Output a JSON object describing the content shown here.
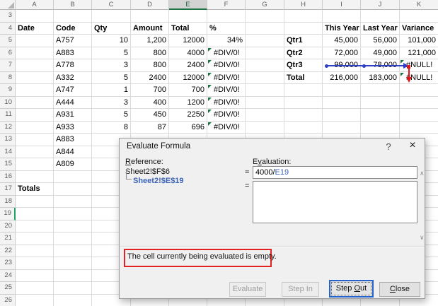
{
  "colors": {
    "excel_green": "#217346",
    "active_row_marker": "#21A366",
    "error_indicator": "#1E7145",
    "trace_blue": "#2F3FC6",
    "trace_red": "#DD1A1A",
    "reference_blue": "#3B63B8",
    "message_border_red": "#E32121",
    "focused_button_border": "#2663CC"
  },
  "icons": {
    "help": "?",
    "close": "×",
    "scroll_up": "∧",
    "scroll_down": "∨"
  },
  "sheet": {
    "columns": [
      "A",
      "B",
      "C",
      "D",
      "E",
      "F",
      "G",
      "H",
      "I",
      "J",
      "K"
    ],
    "selected_column": "E",
    "row_numbers": [
      3,
      4,
      5,
      6,
      7,
      8,
      9,
      10,
      11,
      12,
      13,
      14,
      15,
      16,
      17,
      18,
      19,
      20,
      21,
      22,
      23,
      24,
      25,
      26
    ],
    "active_row": 19,
    "cells": [
      {
        "ref": "A4",
        "text": "Date",
        "bold": true
      },
      {
        "ref": "B4",
        "text": "Code",
        "bold": true
      },
      {
        "ref": "C4",
        "text": "Qty",
        "bold": true
      },
      {
        "ref": "D4",
        "text": "Amount",
        "bold": true
      },
      {
        "ref": "E4",
        "text": "Total",
        "bold": true
      },
      {
        "ref": "F4",
        "text": "%",
        "bold": true
      },
      {
        "ref": "I4",
        "text": "This Year",
        "bold": true
      },
      {
        "ref": "J4",
        "text": "Last Year",
        "bold": true
      },
      {
        "ref": "K4",
        "text": "Variance",
        "bold": true
      },
      {
        "ref": "B5",
        "text": "A757"
      },
      {
        "ref": "C5",
        "text": "10",
        "align": "right"
      },
      {
        "ref": "D5",
        "text": "1,200",
        "align": "right"
      },
      {
        "ref": "E5",
        "text": "12000",
        "align": "right"
      },
      {
        "ref": "F5",
        "text": "34%",
        "align": "right"
      },
      {
        "ref": "H5",
        "text": "Qtr1",
        "bold": true
      },
      {
        "ref": "I5",
        "text": "45,000",
        "align": "right"
      },
      {
        "ref": "J5",
        "text": "56,000",
        "align": "right"
      },
      {
        "ref": "K5",
        "text": "101,000",
        "align": "right"
      },
      {
        "ref": "B6",
        "text": "A883"
      },
      {
        "ref": "C6",
        "text": "5",
        "align": "right"
      },
      {
        "ref": "D6",
        "text": "800",
        "align": "right"
      },
      {
        "ref": "E6",
        "text": "4000",
        "align": "right"
      },
      {
        "ref": "F6",
        "text": "#DIV/0!",
        "err": true
      },
      {
        "ref": "H6",
        "text": "Qtr2",
        "bold": true
      },
      {
        "ref": "I6",
        "text": "72,000",
        "align": "right"
      },
      {
        "ref": "J6",
        "text": "49,000",
        "align": "right"
      },
      {
        "ref": "K6",
        "text": "121,000",
        "align": "right"
      },
      {
        "ref": "B7",
        "text": "A778"
      },
      {
        "ref": "C7",
        "text": "3",
        "align": "right"
      },
      {
        "ref": "D7",
        "text": "800",
        "align": "right"
      },
      {
        "ref": "E7",
        "text": "2400",
        "align": "right"
      },
      {
        "ref": "F7",
        "text": "#DIV/0!",
        "err": true
      },
      {
        "ref": "H7",
        "text": "Qtr3",
        "bold": true
      },
      {
        "ref": "I7",
        "text": "99,000",
        "align": "right"
      },
      {
        "ref": "J7",
        "text": "78,000",
        "align": "right"
      },
      {
        "ref": "K7",
        "text": "#NULL!",
        "err": true
      },
      {
        "ref": "B8",
        "text": "A332"
      },
      {
        "ref": "C8",
        "text": "5",
        "align": "right"
      },
      {
        "ref": "D8",
        "text": "2400",
        "align": "right"
      },
      {
        "ref": "E8",
        "text": "12000",
        "align": "right"
      },
      {
        "ref": "F8",
        "text": "#DIV/0!",
        "err": true
      },
      {
        "ref": "H8",
        "text": "Total",
        "bold": true
      },
      {
        "ref": "I8",
        "text": "216,000",
        "align": "right"
      },
      {
        "ref": "J8",
        "text": "183,000",
        "align": "right"
      },
      {
        "ref": "K8",
        "text": "#NULL!",
        "err": true
      },
      {
        "ref": "B9",
        "text": "A747"
      },
      {
        "ref": "C9",
        "text": "1",
        "align": "right"
      },
      {
        "ref": "D9",
        "text": "700",
        "align": "right"
      },
      {
        "ref": "E9",
        "text": "700",
        "align": "right"
      },
      {
        "ref": "F9",
        "text": "#DIV/0!",
        "err": true
      },
      {
        "ref": "B10",
        "text": "A444"
      },
      {
        "ref": "C10",
        "text": "3",
        "align": "right"
      },
      {
        "ref": "D10",
        "text": "400",
        "align": "right"
      },
      {
        "ref": "E10",
        "text": "1200",
        "align": "right"
      },
      {
        "ref": "F10",
        "text": "#DIV/0!",
        "err": true
      },
      {
        "ref": "B11",
        "text": "A931"
      },
      {
        "ref": "C11",
        "text": "5",
        "align": "right"
      },
      {
        "ref": "D11",
        "text": "450",
        "align": "right"
      },
      {
        "ref": "E11",
        "text": "2250",
        "align": "right"
      },
      {
        "ref": "F11",
        "text": "#DIV/0!",
        "err": true
      },
      {
        "ref": "B12",
        "text": "A933"
      },
      {
        "ref": "C12",
        "text": "8",
        "align": "right"
      },
      {
        "ref": "D12",
        "text": "87",
        "align": "right"
      },
      {
        "ref": "E12",
        "text": "696",
        "align": "right"
      },
      {
        "ref": "F12",
        "text": "#DIV/0!",
        "err": true
      },
      {
        "ref": "B13",
        "text": "A883"
      },
      {
        "ref": "B14",
        "text": "A844"
      },
      {
        "ref": "B15",
        "text": "A809"
      },
      {
        "ref": "A17",
        "text": "Totals",
        "bold": true
      }
    ],
    "trace": {
      "precedent_cells": [
        "I7",
        "J7"
      ],
      "arrow_target_cell": "K7",
      "error_arrow_cell": "K8"
    }
  },
  "dialog": {
    "title": "Evaluate Formula",
    "reference_label": {
      "pre": "",
      "u": "R",
      "post": "eference:"
    },
    "evaluation_label": {
      "pre": "E",
      "u": "v",
      "post": "aluation:"
    },
    "reference_value": "Sheet2!$F$6",
    "equals": "=",
    "evaluation_formula": {
      "plain": "4000/",
      "ref": "E19"
    },
    "sub_reference": "Sheet2!$E$19",
    "message": "The cell currently being evaluated is empty.",
    "buttons": {
      "evaluate": {
        "pre": "Evaluate",
        "u": "",
        "post": ""
      },
      "step_in": {
        "pre": "Step In",
        "u": "",
        "post": ""
      },
      "step_out": {
        "pre": "Step ",
        "u": "O",
        "post": "ut"
      },
      "close": {
        "pre": "",
        "u": "C",
        "post": "lose"
      }
    }
  }
}
